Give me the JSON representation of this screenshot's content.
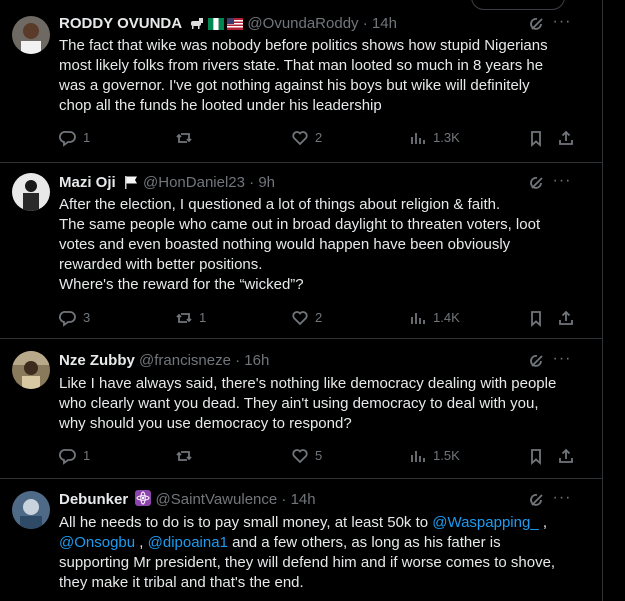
{
  "tweets": [
    {
      "name": "RODDY OVUNDA",
      "badges": [
        "goat-emoji",
        "nigeria-flag",
        "usa-flag"
      ],
      "handle": "@OvundaRoddy",
      "time": "14h",
      "lines": [
        "The fact that wike was nobody before politics shows how stupid Nigerians",
        "most likely folks from rivers state. That man looted so much in 8 years he",
        "was a governor. I've got nothing against his boys but wike will definitely",
        "chop all the funds he looted under his leadership"
      ],
      "replies": "1",
      "reposts": "",
      "likes": "2",
      "views": "1.3K"
    },
    {
      "name": "Mazi Oji",
      "badges": [
        "white-flag"
      ],
      "handle": "@HonDaniel23",
      "time": "9h",
      "lines": [
        "After the election, I questioned a lot of things about religion & faith.",
        "The same people who came out in broad daylight to threaten voters, loot",
        "votes and even boasted nothing would happen have been obviously",
        "rewarded with better positions.",
        "Where's the reward for the “wicked”?"
      ],
      "replies": "3",
      "reposts": "1",
      "likes": "2",
      "views": "1.4K"
    },
    {
      "name": "Nze Zubby",
      "badges": [],
      "handle": "@francisneze",
      "time": "16h",
      "lines": [
        "Like I have always said, there's nothing like democracy dealing with people",
        "who clearly want you dead. They ain't using democracy to deal with you,",
        "why should you use democracy to respond?"
      ],
      "replies": "1",
      "reposts": "",
      "likes": "5",
      "views": "1.5K"
    },
    {
      "name": "Debunker",
      "badges": [
        "atom-emoji"
      ],
      "handle": "@SaintVawulence",
      "time": "14h",
      "line1_a": "All he needs to do is to pay small money, at least 50k to ",
      "mention1": "@Waspapping_",
      "line1_b": " ,",
      "mention2": "@Onsogbu",
      "sep1": " , ",
      "mention3": "@dipoaina1",
      "line2_b": " and a few others, as long as his father is",
      "line3": "supporting Mr president, they will defend him and if worse comes to shove,",
      "line4": "they make it tribal and that's the end."
    }
  ],
  "icons": {
    "reply": "reply-icon",
    "repost": "repost-icon",
    "like": "heart-icon",
    "views": "views-icon",
    "bookmark": "bookmark-icon",
    "share": "share-icon",
    "grok": "grok-icon",
    "more": "more-icon"
  },
  "more_glyph": "···",
  "dot": "·"
}
